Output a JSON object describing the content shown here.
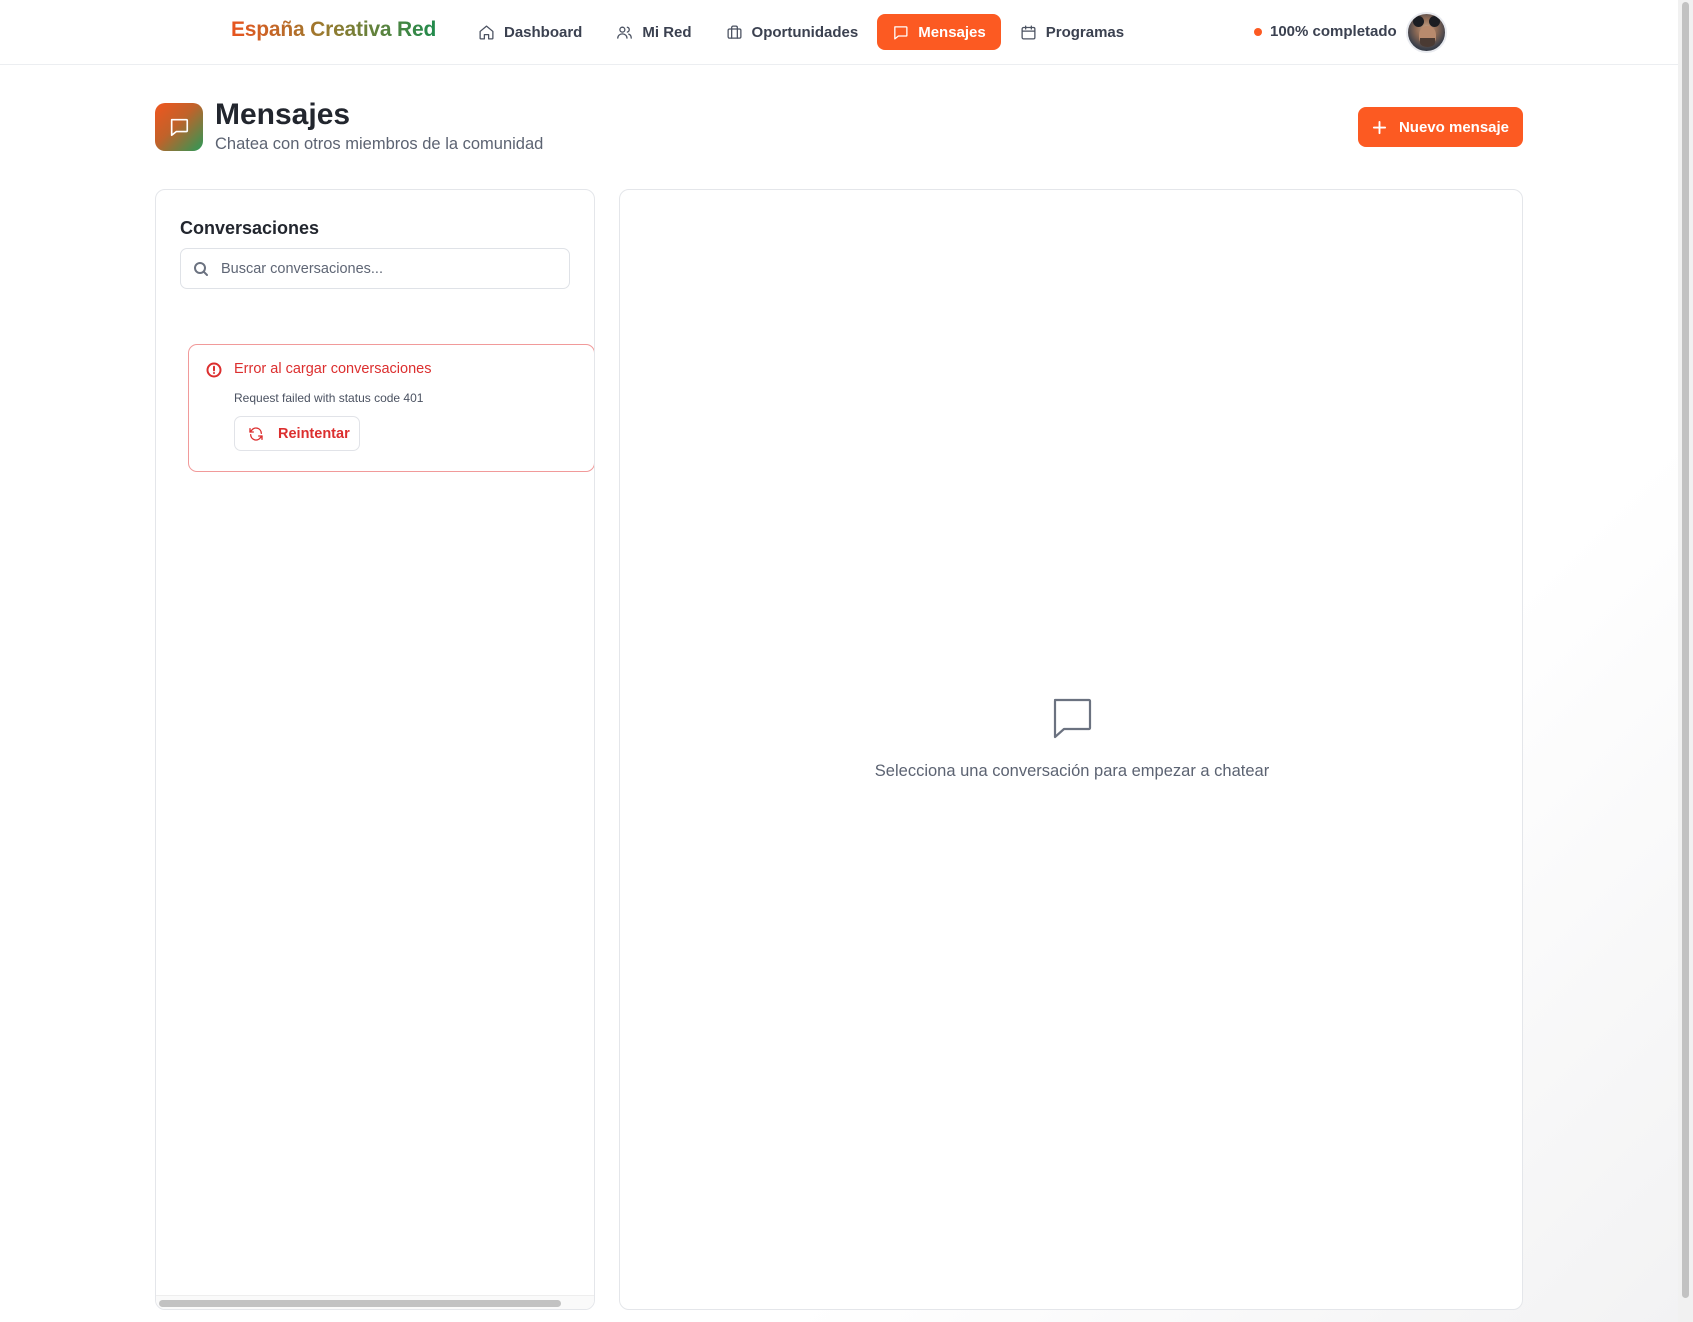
{
  "brand": {
    "name": "España Creativa Red"
  },
  "nav": {
    "items": [
      {
        "label": "Dashboard",
        "icon": "home-icon"
      },
      {
        "label": "Mi Red",
        "icon": "users-icon"
      },
      {
        "label": "Oportunidades",
        "icon": "briefcase-icon"
      },
      {
        "label": "Mensajes",
        "icon": "message-icon",
        "active": true
      },
      {
        "label": "Programas",
        "icon": "calendar-icon"
      }
    ],
    "profile_status": "100% completado",
    "profile_progress": 1.0
  },
  "page": {
    "title": "Mensajes",
    "subtitle": "Chatea con otros miembros de la comunidad",
    "icon": "message-icon",
    "new_message_label": "Nuevo mensaje"
  },
  "conversations": {
    "title": "Conversaciones",
    "search_placeholder": "Buscar conversaciones...",
    "search_value": "",
    "error": {
      "title": "Error al cargar conversaciones",
      "detail": "Request failed with status code 401",
      "retry_label": "Reintentar"
    }
  },
  "chat": {
    "empty_text": "Selecciona una conversación para empezar a chatear",
    "empty_icon": "message-icon"
  },
  "colors": {
    "accent": "#fc5a22",
    "error": "#dc2f2f",
    "brand_gradient_start": "#e8541f",
    "brand_gradient_end": "#1f8a4c"
  }
}
